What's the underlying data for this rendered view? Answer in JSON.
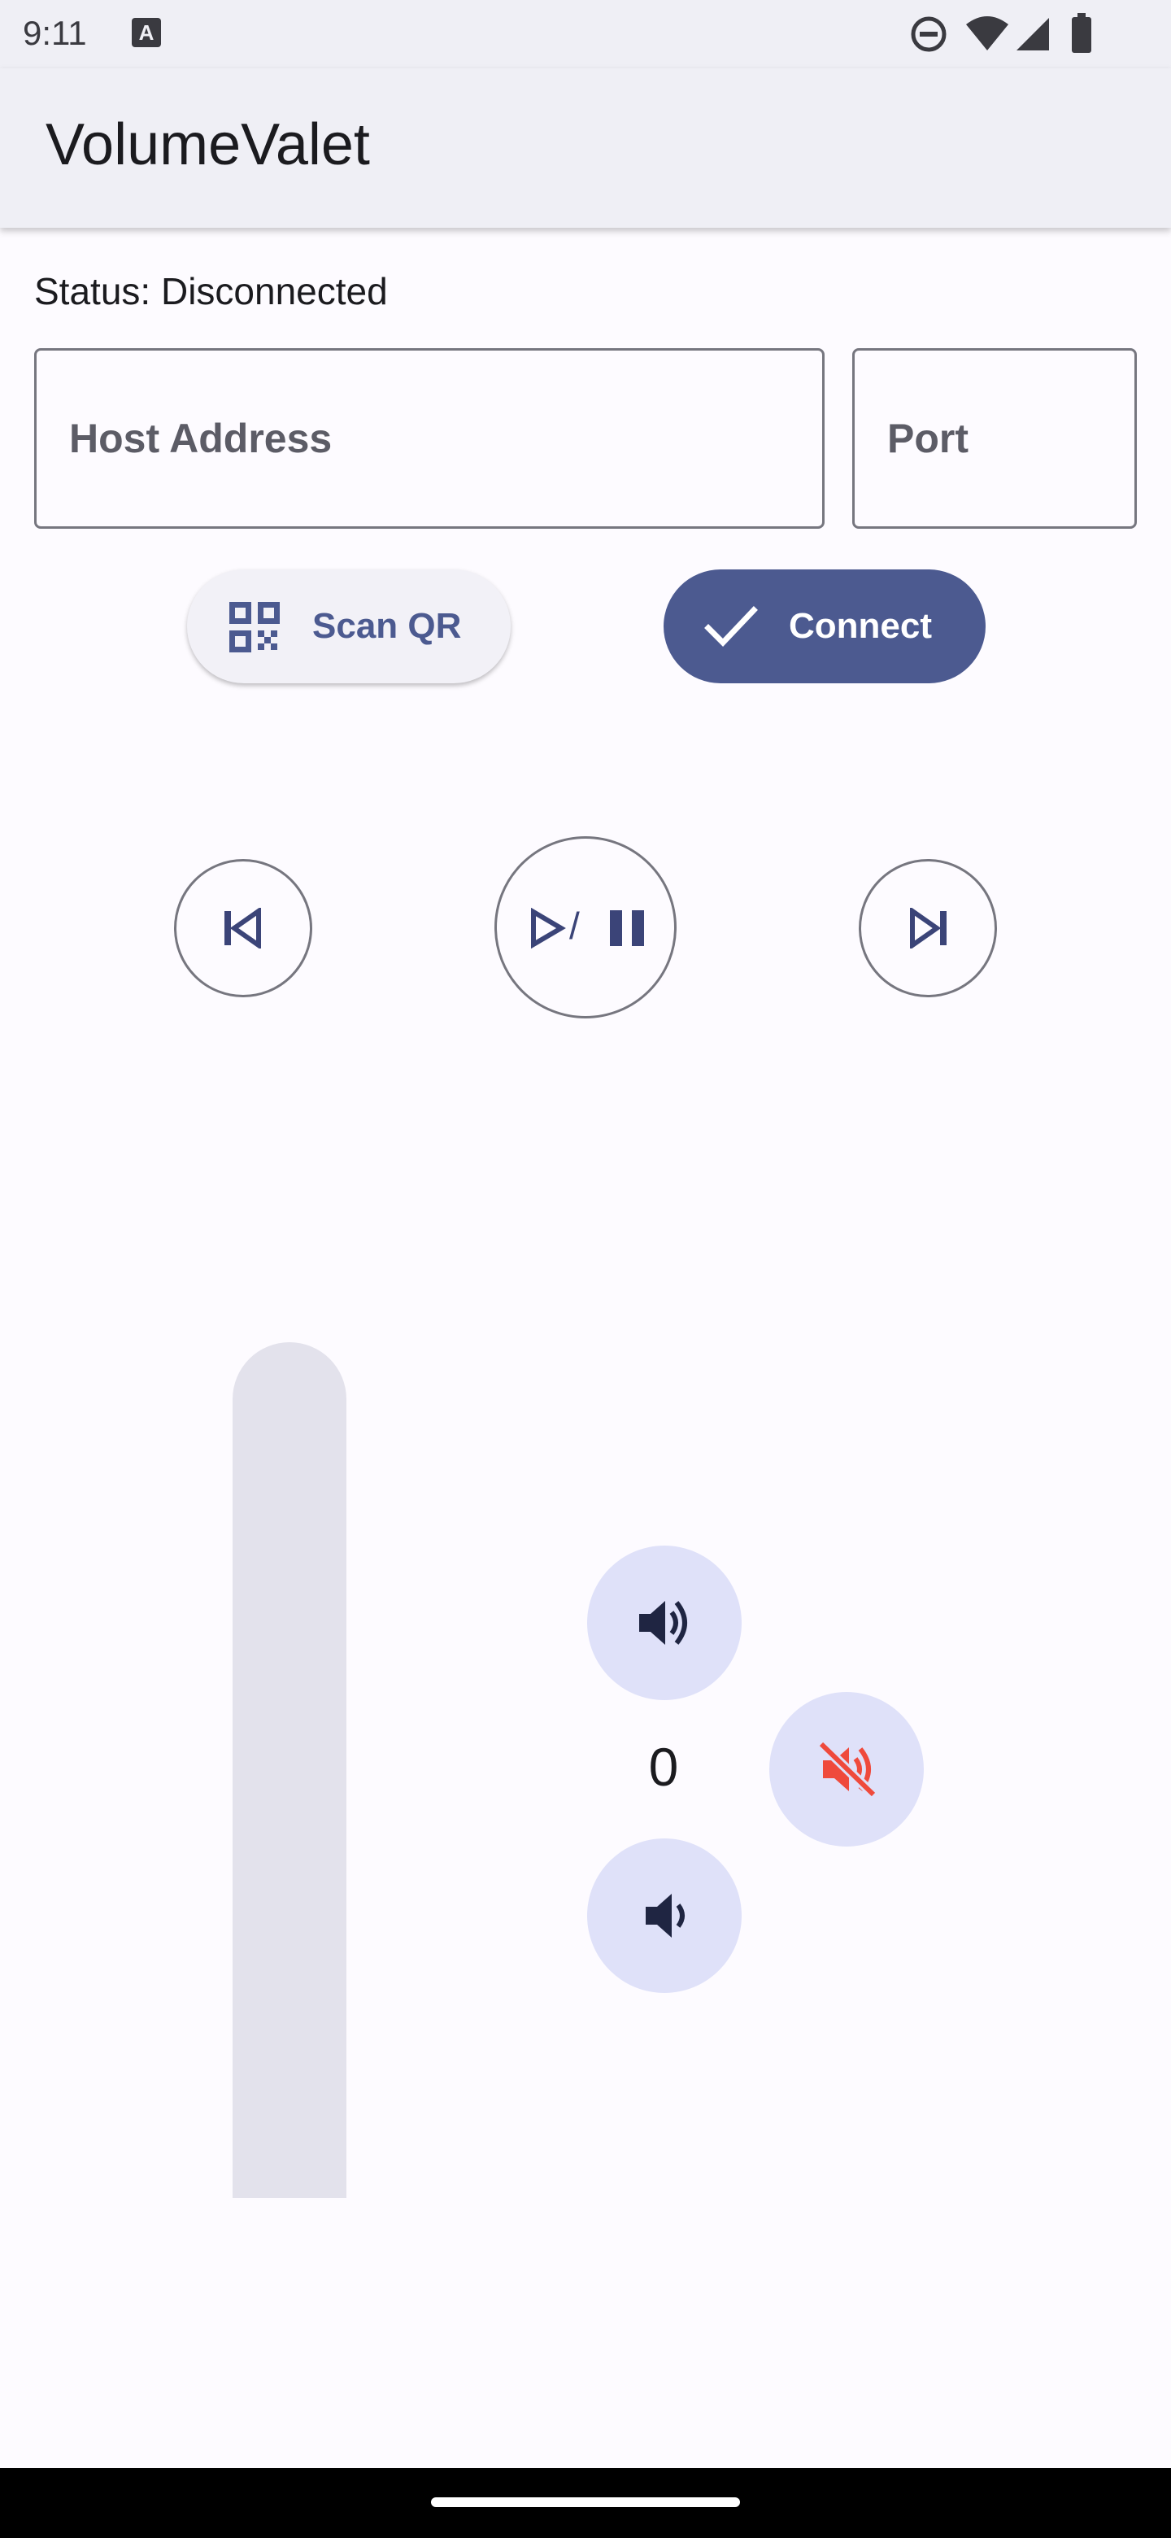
{
  "status_bar": {
    "time": "9:11",
    "notification_icon": "A",
    "icons": [
      "do-not-disturb-icon",
      "wifi-icon",
      "signal-icon",
      "battery-icon"
    ]
  },
  "app": {
    "title": "VolumeValet"
  },
  "connection": {
    "status": "Status: Disconnected",
    "host_placeholder": "Host Address",
    "host_value": "",
    "port_placeholder": "Port",
    "port_value": "",
    "scan_label": "Scan QR",
    "connect_label": "Connect"
  },
  "media": {
    "previous_icon": "skip-previous-icon",
    "play_pause_icon": "play-pause-icon",
    "play_pause_separator": "/",
    "next_icon": "skip-next-icon"
  },
  "volume": {
    "value": "0",
    "level_fraction": 0,
    "up_icon": "volume-up-icon",
    "down_icon": "volume-down-icon",
    "mute_icon": "volume-off-icon"
  },
  "colors": {
    "primary": "#4c5a90",
    "surface": "#fdfbff",
    "tonal_button": "#dfe1f9",
    "mute_accent": "#ef4a3c",
    "outline": "#76767f"
  }
}
